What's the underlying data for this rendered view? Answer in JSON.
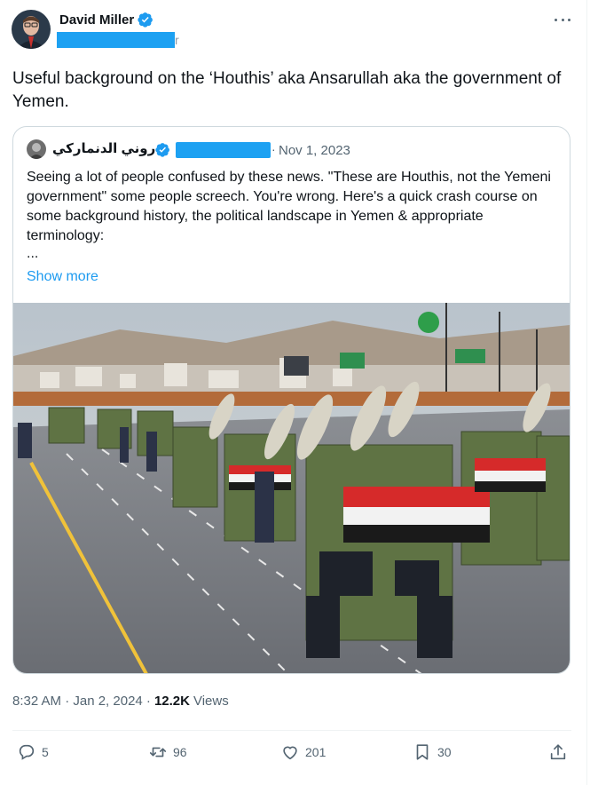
{
  "author": {
    "display_name": "David Miller",
    "handle_tail": "r",
    "avatar_icon": "profile-photo",
    "verified_icon": "verified-badge-icon",
    "colors": {
      "verified": "#1d9bf0",
      "redaction": "#1da1f2"
    }
  },
  "tweet": {
    "text": "Useful background on the ‘Houthis’ aka Ansarullah aka the government of Yemen.",
    "more_icon": "more-icon"
  },
  "quote": {
    "display_name": "روني الدنماركي",
    "separator": "·",
    "date": "Nov 1, 2023",
    "text": "Seeing a lot of people confused by these news. \"These are Houthis, not the Yemeni government\" some people screech. You're wrong. Here's a quick crash course on some background history, the political landscape in Yemen & appropriate terminology:",
    "ellipsis": "...",
    "show_more": "Show more",
    "image_icon": "military-parade-photo"
  },
  "meta": {
    "time": "8:32 AM · Jan 2, 2024 ·",
    "views_count": "12.2K",
    "views_label": "Views"
  },
  "actions": {
    "reply_count": "5",
    "retweet_count": "96",
    "like_count": "201",
    "bookmark_count": "30",
    "icons": [
      "reply-icon",
      "retweet-icon",
      "like-icon",
      "bookmark-icon",
      "share-icon"
    ]
  },
  "colors": {
    "text": "#0f1419",
    "secondary": "#536471",
    "link": "#1d9bf0",
    "border": "#cfd9de"
  }
}
